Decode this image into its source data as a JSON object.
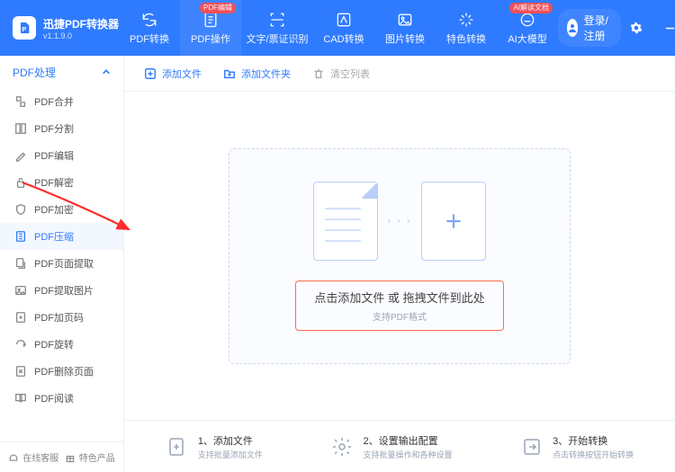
{
  "brand": {
    "title": "迅捷PDF转换器",
    "version": "v1.1.9.0",
    "logo_letter": "P"
  },
  "topnav": [
    {
      "label": "PDF转换",
      "badge": null
    },
    {
      "label": "PDF操作",
      "badge": "PDF编辑"
    },
    {
      "label": "文字/票证识别",
      "badge": null
    },
    {
      "label": "CAD转换",
      "badge": null
    },
    {
      "label": "图片转换",
      "badge": null
    },
    {
      "label": "特色转换",
      "badge": null
    },
    {
      "label": "AI大模型",
      "badge": "AI解读文档"
    }
  ],
  "login_label": "登录/注册",
  "sidebar": {
    "header": "PDF处理",
    "items": [
      {
        "label": "PDF合并"
      },
      {
        "label": "PDF分割"
      },
      {
        "label": "PDF编辑"
      },
      {
        "label": "PDF解密"
      },
      {
        "label": "PDF加密"
      },
      {
        "label": "PDF压缩"
      },
      {
        "label": "PDF页面提取"
      },
      {
        "label": "PDF提取图片"
      },
      {
        "label": "PDF加页码"
      },
      {
        "label": "PDF旋转"
      },
      {
        "label": "PDF删除页面"
      },
      {
        "label": "PDF阅读"
      }
    ],
    "footer": {
      "left": "在线客服",
      "right": "特色产品"
    }
  },
  "toolbar": {
    "add_file": "添加文件",
    "add_folder": "添加文件夹",
    "clear_list": "清空列表"
  },
  "dropzone": {
    "line1": "点击添加文件 或 拖拽文件到此处",
    "line2": "支持PDF格式",
    "arrows": "› › ›"
  },
  "steps": [
    {
      "title": "1、添加文件",
      "sub": "支持批量添加文件"
    },
    {
      "title": "2、设置输出配置",
      "sub": "支持批量操作和各种设置"
    },
    {
      "title": "3、开始转换",
      "sub": "点击转换按钮开始转换"
    }
  ]
}
